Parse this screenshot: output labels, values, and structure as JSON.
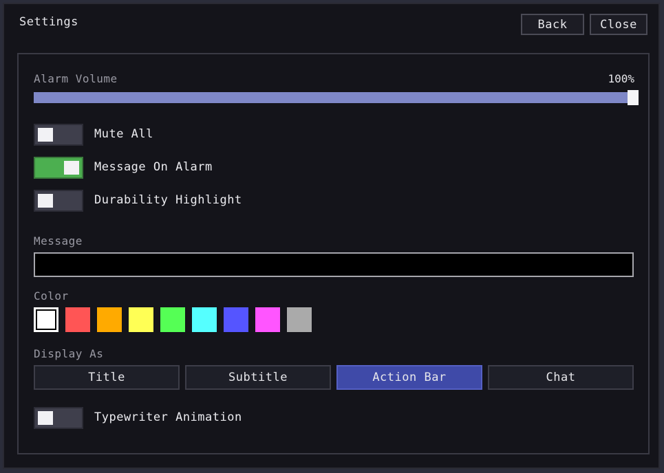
{
  "window": {
    "title": "Settings"
  },
  "header": {
    "back_label": "Back",
    "close_label": "Close"
  },
  "alarm_volume": {
    "label": "Alarm Volume",
    "value_text": "100%",
    "level": 1.0
  },
  "toggles": [
    {
      "label": "Mute All",
      "state": "off"
    },
    {
      "label": "Message On Alarm",
      "state": "on"
    },
    {
      "label": "Durability Highlight",
      "state": "off"
    }
  ],
  "message": {
    "label": "Message",
    "value": "",
    "placeholder": ""
  },
  "color": {
    "label": "Color",
    "swatches": [
      "#ffffff",
      "#ff5555",
      "#ffaa00",
      "#ffff55",
      "#55ff55",
      "#55ffff",
      "#5555ff",
      "#ff55ff",
      "#aaaaaa"
    ],
    "selected_index": 0
  },
  "display_as": {
    "label": "Display As",
    "options": [
      "Title",
      "Subtitle",
      "Action Bar",
      "Chat"
    ],
    "selected": "Action Bar"
  },
  "typewriter": {
    "label": "Typewriter Animation",
    "state": "off"
  }
}
